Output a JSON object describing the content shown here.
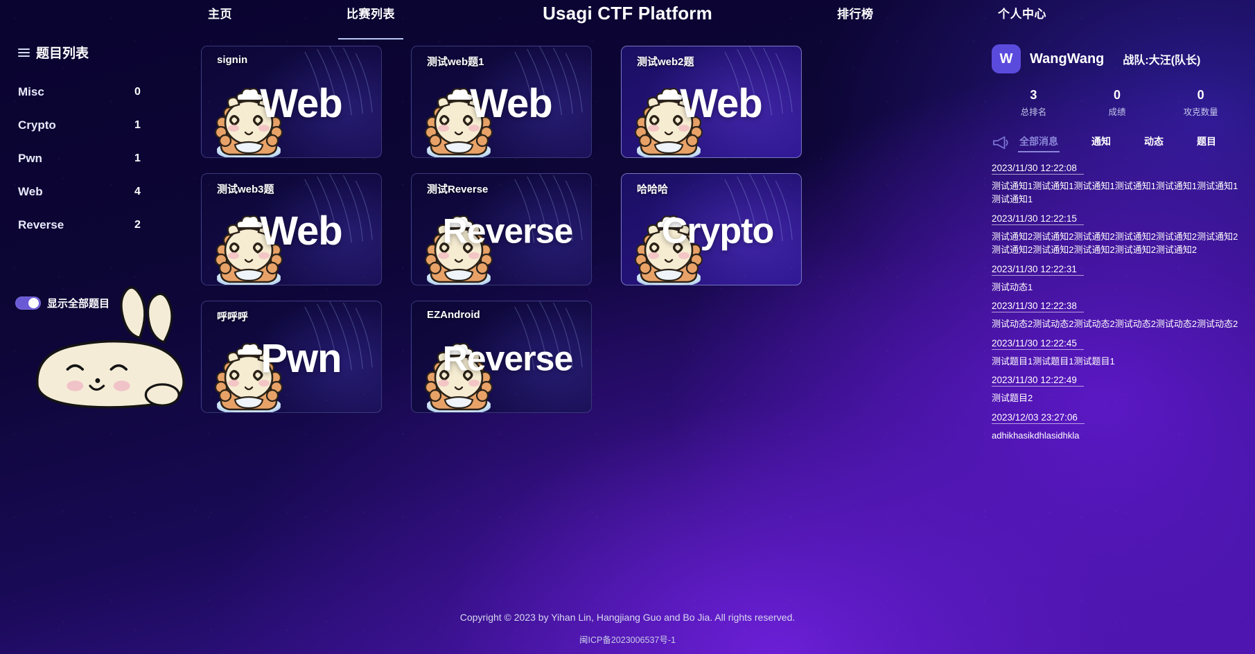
{
  "header": {
    "title": "Usagi CTF Platform",
    "nav": [
      {
        "label": "主页",
        "active": false
      },
      {
        "label": "比赛列表",
        "active": true
      },
      {
        "label": "排行榜",
        "active": false
      },
      {
        "label": "个人中心",
        "active": false
      }
    ]
  },
  "sidebar": {
    "title": "题目列表",
    "icon": "list-icon",
    "categories": [
      {
        "name": "Misc",
        "count": "0"
      },
      {
        "name": "Crypto",
        "count": "1"
      },
      {
        "name": "Pwn",
        "count": "1"
      },
      {
        "name": "Web",
        "count": "4"
      },
      {
        "name": "Reverse",
        "count": "2"
      }
    ],
    "toggle": {
      "label": "显示全部题目",
      "on": true
    }
  },
  "challenges": [
    {
      "title": "signin",
      "category": "Web",
      "highlight": false
    },
    {
      "title": "测试web题1",
      "category": "Web",
      "highlight": false
    },
    {
      "title": "测试web2题",
      "category": "Web",
      "highlight": true
    },
    {
      "title": "测试web3题",
      "category": "Web",
      "highlight": false
    },
    {
      "title": "测试Reverse",
      "category": "Reverse",
      "highlight": false
    },
    {
      "title": "哈哈哈",
      "category": "Crypto",
      "highlight": true
    },
    {
      "title": "呼呼呼",
      "category": "Pwn",
      "highlight": false
    },
    {
      "title": "EZAndroid",
      "category": "Reverse",
      "highlight": false
    }
  ],
  "user": {
    "avatar_letter": "W",
    "name": "WangWang",
    "team": "战队:大汪(队长)",
    "stats": [
      {
        "value": "3",
        "label": "总排名"
      },
      {
        "value": "0",
        "label": "成绩"
      },
      {
        "value": "0",
        "label": "攻克数量"
      }
    ]
  },
  "messages": {
    "icon": "megaphone-icon",
    "tabs": [
      {
        "label": "全部消息",
        "active": true
      },
      {
        "label": "通知",
        "active": false
      },
      {
        "label": "动态",
        "active": false
      },
      {
        "label": "题目",
        "active": false
      }
    ],
    "items": [
      {
        "time": "2023/11/30 12:22:08",
        "body": "测试通知1测试通知1测试通知1测试通知1测试通知1测试通知1测试通知1"
      },
      {
        "time": "2023/11/30 12:22:15",
        "body": "测试通知2测试通知2测试通知2测试通知2测试通知2测试通知2测试通知2测试通知2测试通知2测试通知2测试通知2"
      },
      {
        "time": "2023/11/30 12:22:31",
        "body": "测试动态1"
      },
      {
        "time": "2023/11/30 12:22:38",
        "body": "测试动态2测试动态2测试动态2测试动态2测试动态2测试动态2"
      },
      {
        "time": "2023/11/30 12:22:45",
        "body": "测试题目1测试题目1测试题目1"
      },
      {
        "time": "2023/11/30 12:22:49",
        "body": "测试题目2"
      },
      {
        "time": "2023/12/03 23:27:06",
        "body": "adhikhasikdhlasidhkla"
      }
    ]
  },
  "footer": {
    "copyright": "Copyright © 2023 by Yihan Lin, Hangjiang Guo and Bo Jia. All rights reserved.",
    "icp": "闽ICP备2023006537号-1"
  },
  "colors": {
    "accent": "#5b4bdd",
    "bg_dark": "#0c0530",
    "bg_purple": "#4a14ab",
    "tab_active": "#8b86d8"
  }
}
